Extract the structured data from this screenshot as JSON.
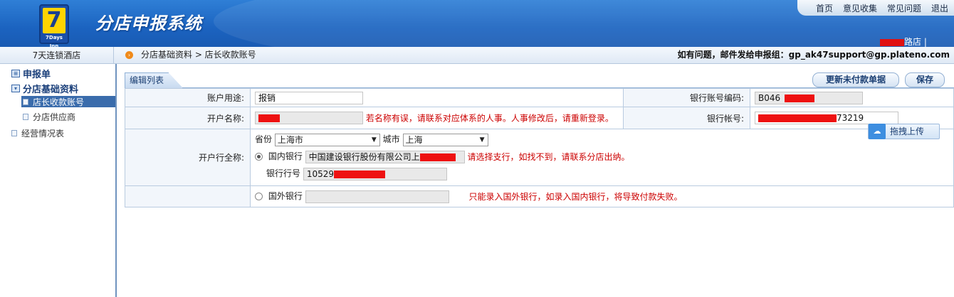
{
  "header": {
    "logo_number": "7",
    "logo_sub": "7Days Inn",
    "app_title": "分店申报系统",
    "nav": [
      "首页",
      "意见收集",
      "常见问题",
      "退出"
    ],
    "store_suffix": "路店 |"
  },
  "subbar": {
    "hotel": "7天连锁酒店",
    "breadcrumb": "分店基础资料 > 店长收款账号",
    "help": "如有问题，邮件发给申报组：gp_ak47support@gp.plateno.com"
  },
  "sidebar": {
    "items": [
      {
        "label": "申报单",
        "level": 1
      },
      {
        "label": "分店基础资料",
        "level": 1
      },
      {
        "label": "店长收款账号",
        "level": 2,
        "active": true
      },
      {
        "label": "分店供应商",
        "level": 2
      },
      {
        "label": "经营情况表",
        "level": 1
      }
    ]
  },
  "main": {
    "tab": "编辑列表",
    "buttons": {
      "update_unpaid": "更新未付款单据",
      "save": "保存"
    },
    "upload_button": "拖拽上传",
    "fields": {
      "usage_label": "账户用途:",
      "usage_value": "报销",
      "bank_code_label": "银行账号编码:",
      "bank_code_value": "B046",
      "account_name_label": "开户名称:",
      "account_name_warning": "若名称有误，请联系对应体系的人事。人事修改后，请重新登录。",
      "account_no_label": "银行帐号:",
      "account_no_value": "73219",
      "bank_fullname_label": "开户行全称:",
      "province_label": "省份",
      "province_value": "上海市",
      "city_label": "城市",
      "city_value": "上海",
      "domestic_label": "国内银行",
      "domestic_value": "中国建设银行股份有限公司上",
      "domestic_warning": "请选择支行，如找不到，请联系分店出纳。",
      "bank_no_label": "银行行号",
      "bank_no_value": "10529",
      "foreign_label": "国外银行",
      "foreign_warning": "只能录入国外银行，如录入国内银行，将导致付款失败。"
    }
  }
}
